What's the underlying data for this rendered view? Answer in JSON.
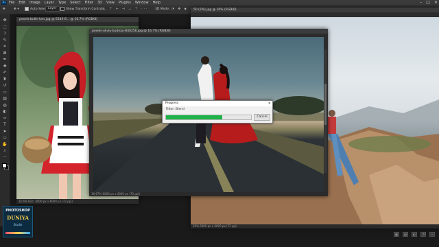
{
  "app": {
    "logo_text": "Ps",
    "menus": [
      "File",
      "Edit",
      "Image",
      "Layer",
      "Type",
      "Select",
      "Filter",
      "3D",
      "View",
      "Plugins",
      "Window",
      "Help"
    ],
    "window_controls": [
      "–",
      "□",
      "✕"
    ]
  },
  "options_bar": {
    "auto_select_label": "Auto-Select:",
    "auto_select_value": "Layer",
    "transform_label": "Show Transform Controls",
    "mode_label": "3D Mode:"
  },
  "documents": {
    "left": {
      "title": "pexels-bulle-lum.jpg @ 6343-6... @ 16.7% (RGB/8)",
      "status": "16.6%    Doc: 4000 px x 6000 px (72 ppi)"
    },
    "center": {
      "title": "pexels-oliviu-budeau-840256.jpg @ 16.7% (RGB/8)",
      "status": "16.67%    6000 px x 4000 px (72 ppi)"
    },
    "right": {
      "title": "50 (2%) jpg @ 16% (RGB/8)",
      "status": "20%    6000 px x 4000 px (72 ppi)"
    }
  },
  "progress_dialog": {
    "title": "Progress",
    "close": "✕",
    "message": "Filter: Blend",
    "progress_fraction": 0.66,
    "cancel_label": "Cancel"
  },
  "badge": {
    "top": "PHOTOSHOP",
    "main": "DUNIYA",
    "sub": "Studio"
  },
  "colors": {
    "progress_green": "#1fb34a",
    "accent_blue": "#31a8ff"
  }
}
